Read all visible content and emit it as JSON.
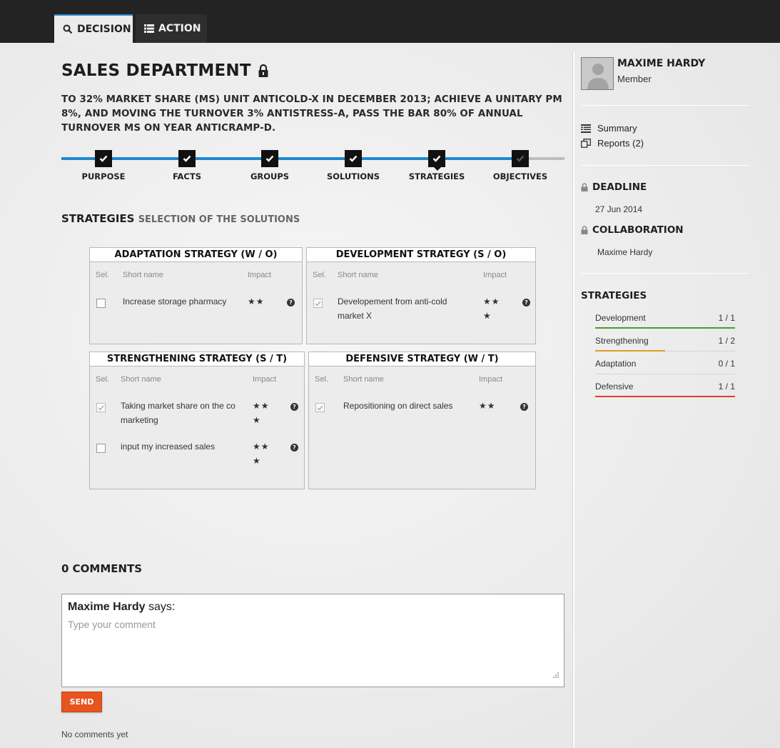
{
  "tabs": [
    {
      "label": "DECISION",
      "icon": "search-icon",
      "active": true
    },
    {
      "label": "ACTION",
      "icon": "list-icon",
      "active": false
    }
  ],
  "header": {
    "title": "SALES DEPARTMENT",
    "objective": "TO 32% MARKET SHARE (MS) UNIT ANTICOLD-X IN DECEMBER 2013; ACHIEVE A UNITARY PM 8%, AND MOVING THE TURNOVER 3% ANTISTRESS-A, PASS THE BAR 80% OF ANNUAL TURNOVER MS ON YEAR ANTICRAMP-D."
  },
  "steps": [
    {
      "label": "PURPOSE",
      "done": true
    },
    {
      "label": "FACTS",
      "done": true
    },
    {
      "label": "GROUPS",
      "done": true
    },
    {
      "label": "SOLUTIONS",
      "done": true
    },
    {
      "label": "STRATEGIES",
      "done": true,
      "current": true
    },
    {
      "label": "OBJECTIVES",
      "done": false
    }
  ],
  "section": {
    "title": "STRATEGIES",
    "subtitle": "SELECTION OF THE SOLUTIONS"
  },
  "columns": {
    "sel": "Sel.",
    "name": "Short name",
    "impact": "Impact"
  },
  "panels": {
    "adaptation": {
      "title": "ADAPTATION STRATEGY (W / O)",
      "rows": [
        {
          "name": "Increase storage pharmacy",
          "stars": "★★",
          "checked": false
        }
      ]
    },
    "development": {
      "title": "DEVELOPMENT STRATEGY (S / O)",
      "rows": [
        {
          "name_line1": "Developement from anti-cold",
          "name_line2": "market X",
          "stars_line1": "★★",
          "stars_line2": "★",
          "checked": true
        }
      ]
    },
    "strengthening": {
      "title": "STRENGTHENING STRATEGY (S / T)",
      "rows": [
        {
          "name_line1": "Taking market share on the co",
          "name_line2": "marketing",
          "stars_line1": "★★",
          "stars_line2": "★",
          "checked": true
        },
        {
          "name_line1": "input my increased sales",
          "name_line2": "",
          "stars_line1": "★★",
          "stars_line2": "★",
          "checked": false
        }
      ]
    },
    "defensive": {
      "title": "DEFENSIVE STRATEGY (W / T)",
      "rows": [
        {
          "name": "Repositioning on direct sales",
          "stars": "★★",
          "checked": true
        }
      ]
    }
  },
  "help_glyph": "?",
  "comments": {
    "title": "0 COMMENTS",
    "author": "Maxime Hardy",
    "says": "says:",
    "placeholder": "Type your comment",
    "send_label": "SEND",
    "empty_text": "No comments yet"
  },
  "sidebar": {
    "user_name": "MAXIME HARDY",
    "user_role": "Member",
    "links": [
      {
        "label": "Summary",
        "icon": "summary-icon"
      },
      {
        "label": "Reports (2)",
        "icon": "reports-icon"
      }
    ],
    "deadline_label": "DEADLINE",
    "deadline_value": "27 Jun 2014",
    "collaboration_label": "COLLABORATION",
    "collaboration_value": "Maxime Hardy",
    "strategies_title": "STRATEGIES",
    "strategies": [
      {
        "name": "Development",
        "count": "1 / 1",
        "progress": 1.0,
        "color": "#4a9a2e"
      },
      {
        "name": "Strengthening",
        "count": "1 / 2",
        "progress": 0.5,
        "color": "#e0a020"
      },
      {
        "name": "Adaptation",
        "count": "0 / 1",
        "progress": 0.0,
        "color": "#cccccc"
      },
      {
        "name": "Defensive",
        "count": "1 / 1",
        "progress": 1.0,
        "color": "#d9412a"
      }
    ]
  },
  "colors": {
    "accent": "#1e88cf",
    "send": "#e8541e",
    "topbar": "#232323"
  }
}
